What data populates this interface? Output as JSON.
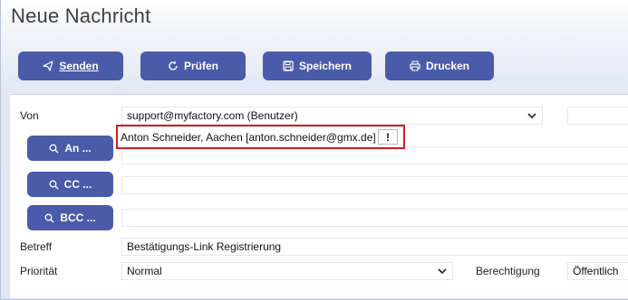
{
  "window": {
    "title": "Neue Nachricht"
  },
  "toolbar": {
    "send_label": "Senden",
    "check_label": "Prüfen",
    "save_label": "Speichern",
    "print_label": "Drucken"
  },
  "form": {
    "from_label": "Von",
    "from_value": "support@myfactory.com (Benutzer)",
    "to_button": "An ...",
    "to_value": "Anton Schneider, Aachen [anton.schneider@gmx.de]",
    "to_warning": "!",
    "cc_button": "CC ...",
    "bcc_button": "BCC ...",
    "subject_label": "Betreff",
    "subject_value": "Bestätigungs-Link Registrierung",
    "priority_label": "Priorität",
    "priority_value": "Normal",
    "permission_label": "Berechtigung",
    "permission_value": "Öffentlich"
  },
  "colors": {
    "button_bg": "#4a5ba9",
    "highlight": "#d21e1e"
  }
}
